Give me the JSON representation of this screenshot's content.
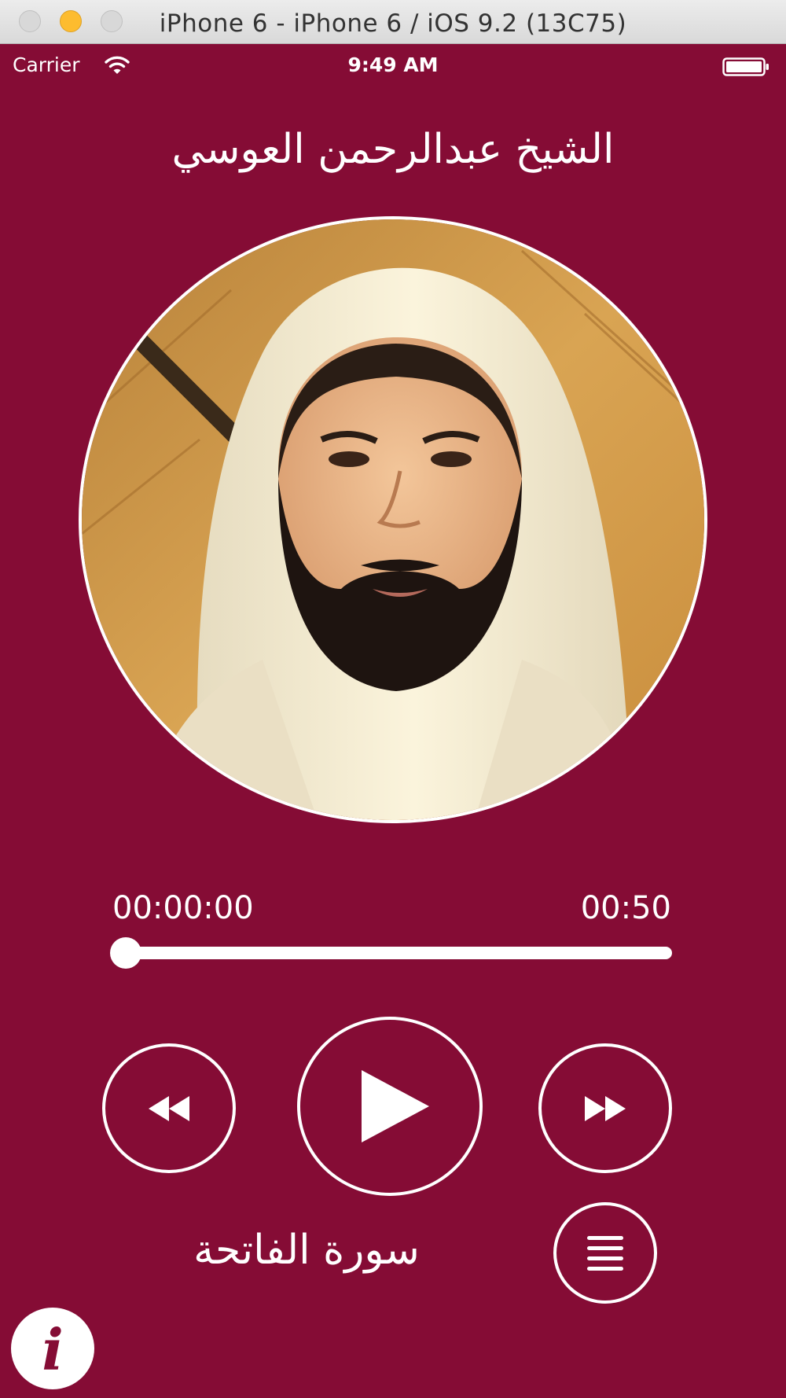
{
  "window": {
    "title": "iPhone 6 - iPhone 6 / iOS 9.2 (13C75)"
  },
  "status_bar": {
    "carrier": "Carrier",
    "time": "9:49 AM"
  },
  "player": {
    "reciter_name": "الشيخ عبدالرحمن العوسي",
    "elapsed_time": "00:00:00",
    "total_time": "00:50",
    "progress": 0,
    "surah_name": "سورة الفاتحة"
  },
  "icons": {
    "info": "i"
  },
  "colors": {
    "background": "#850c35",
    "foreground": "#ffffff"
  }
}
